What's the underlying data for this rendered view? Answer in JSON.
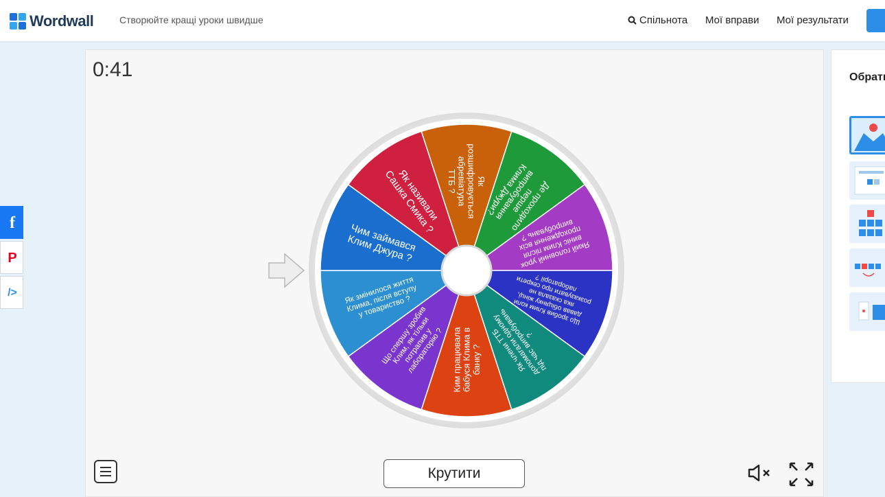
{
  "header": {
    "logo_text": "Wordwall",
    "tagline": "Створюйте кращі уроки швидше",
    "nav": [
      "Спільнота",
      "Мої вправи",
      "Мої результати"
    ]
  },
  "game": {
    "timer": "0:41",
    "spin_label": "Крутити",
    "segments": [
      {
        "text": "Як розшифровується абревіатура ТТБ ?",
        "color": "#c8610a"
      },
      {
        "text": "Де проходило перше випробування Клима Джури?",
        "color": "#1f9a3a"
      },
      {
        "text": "Який головний урок виніс Клим після проходження всіх випробувань ?",
        "color": "#a43bc4"
      },
      {
        "text": "Що зробив Клим коли давав обіцянку жінці, яка сказала не розказувати про секрети лабораторії ?",
        "color": "#2a33c4"
      },
      {
        "text": "Як члени ТТБ допомагали одному під час випробувань ?",
        "color": "#0f8a7c"
      },
      {
        "text": "Ким працювала бабуся Клима в банку ?",
        "color": "#dd4212"
      },
      {
        "text": "Що спершу зробив Клим, як тільки потрапив у лабораторію ?",
        "color": "#7b35cf"
      },
      {
        "text": "Як змінилося життя Клима, після вступу у товариство ?",
        "color": "#2b8fd1"
      },
      {
        "text": "Чим займався Клим Джура ?",
        "color": "#1a6fce"
      },
      {
        "text": "Як називали Сашка Смика ?",
        "color": "#d02040"
      }
    ]
  },
  "side": {
    "title": "Обрати шаблон"
  },
  "share": {
    "facebook": "f",
    "pinterest": "P",
    "embed": "/>"
  },
  "icons": [
    "search-icon",
    "menu-icon",
    "mute-icon",
    "fullscreen-icon",
    "pointer-arrow-icon"
  ]
}
